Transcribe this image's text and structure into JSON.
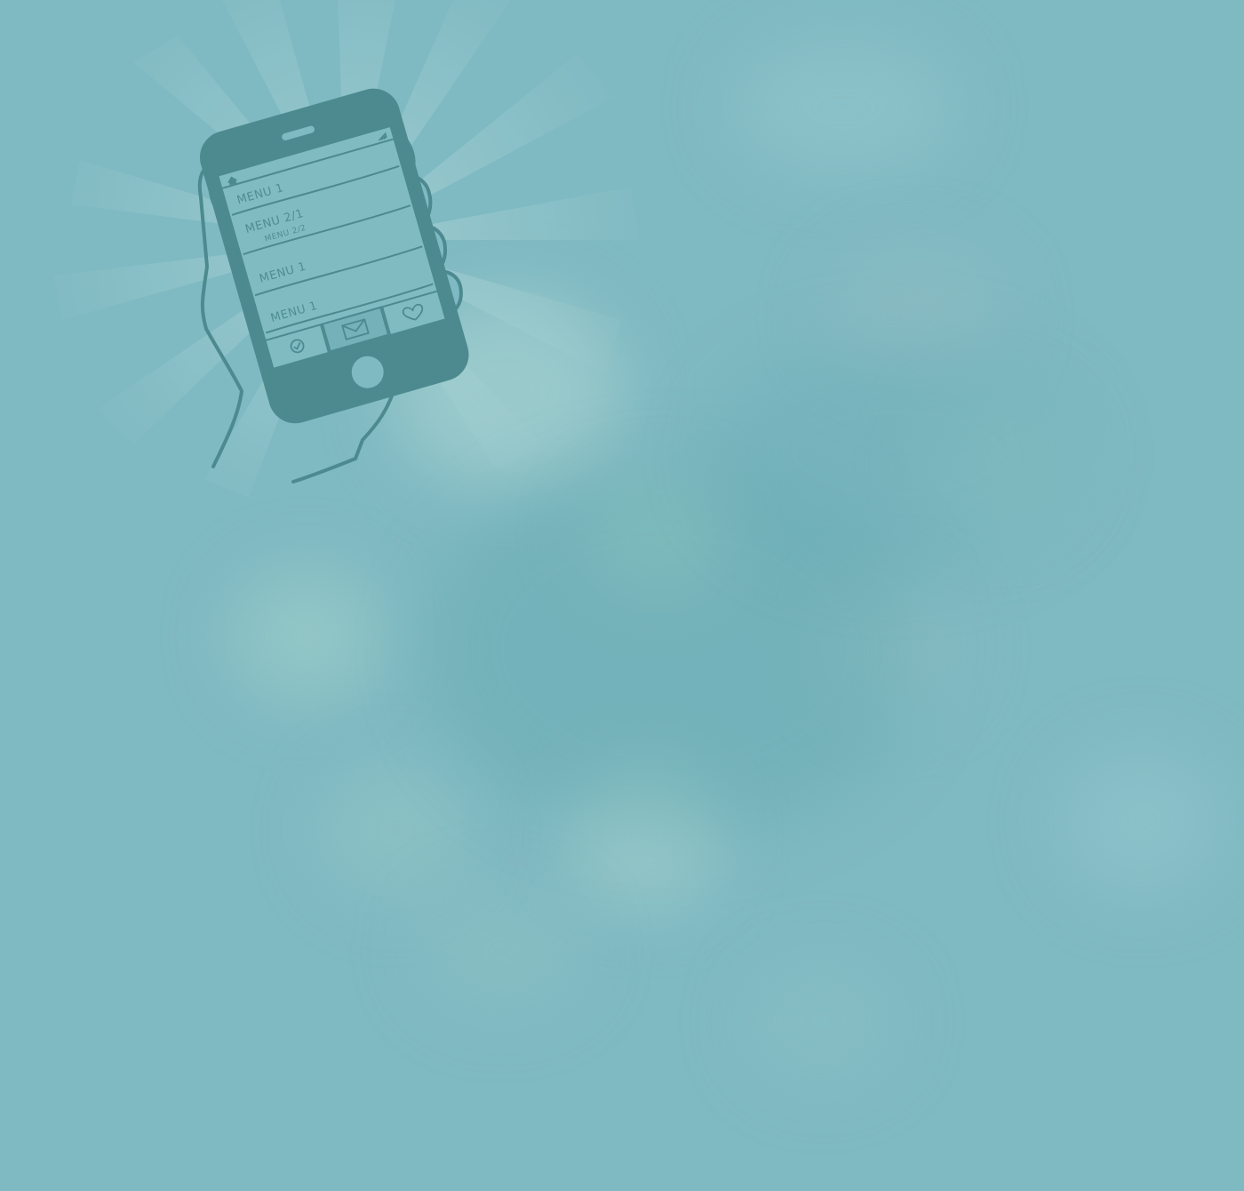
{
  "scene": {
    "background_color": "#7fb9c2",
    "ink_color": "#4c8a8f",
    "screen_color": "#80bbc2",
    "glow_color": "#a9d4d6"
  },
  "phone": {
    "menu_items": [
      {
        "label": "MENU 1"
      },
      {
        "label": "MENU 2/1"
      },
      {
        "label": "MENU 2/2"
      },
      {
        "label": "MENU 1"
      },
      {
        "label": "MENU 1"
      }
    ],
    "icons": {
      "home": "home-icon",
      "signal": "signal-icon",
      "check": "check-icon",
      "mail": "mail-icon",
      "heart": "heart-icon"
    }
  }
}
